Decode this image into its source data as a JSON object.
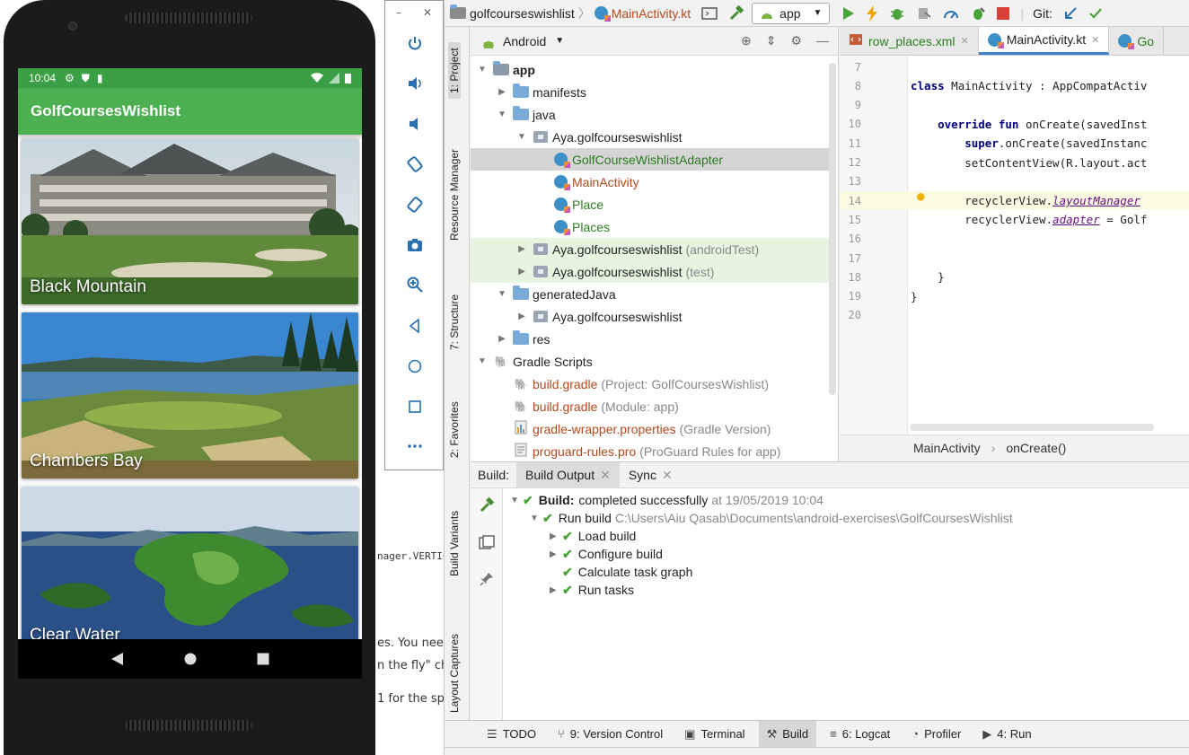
{
  "background_page": {
    "fragments": [
      "nager.VERTIC",
      "es. You need",
      "n the fly\" ch",
      "1 for the sp"
    ]
  },
  "emulator": {
    "window_controls": [
      "–",
      "✕"
    ]
  },
  "phone": {
    "status_time": "10:04",
    "app_title": "GolfCoursesWishlist",
    "places": [
      {
        "name": "Black Mountain"
      },
      {
        "name": "Chambers Bay"
      },
      {
        "name": "Clear Water"
      }
    ]
  },
  "ide": {
    "breadcrumb": {
      "project": "golfcourseswishlist",
      "file": "MainActivity.kt"
    },
    "run_config": "app",
    "git_label": "Git:",
    "left_strip_labels": [
      "1: Project",
      "Resource Manager",
      "7: Structure",
      "2: Favorites",
      "Build Variants",
      "Layout Captures"
    ],
    "project_view": "Android",
    "tree": [
      {
        "label": "app",
        "depth": 0,
        "expanded": true,
        "icon": "module-icon",
        "bold": true
      },
      {
        "label": "manifests",
        "depth": 1,
        "expanded": false,
        "icon": "folder-icon"
      },
      {
        "label": "java",
        "depth": 1,
        "expanded": true,
        "icon": "folder-icon"
      },
      {
        "label": "Aya.golfcourseswishlist",
        "depth": 2,
        "expanded": true,
        "icon": "package-icon"
      },
      {
        "label": "GolfCourseWishlistAdapter",
        "depth": 3,
        "icon": "kotlin-class-icon",
        "color": "#2a7d1f",
        "selected": true
      },
      {
        "label": "MainActivity",
        "depth": 3,
        "icon": "kotlin-class-icon",
        "color": "#b5481b"
      },
      {
        "label": "Place",
        "depth": 3,
        "icon": "kotlin-class-icon",
        "color": "#2a7d1f"
      },
      {
        "label": "Places",
        "depth": 3,
        "icon": "kotlin-class-icon",
        "color": "#2a7d1f"
      },
      {
        "label": "Aya.golfcourseswishlist",
        "suffix": "(androidTest)",
        "depth": 2,
        "expanded": false,
        "icon": "package-icon",
        "test": true
      },
      {
        "label": "Aya.golfcourseswishlist",
        "suffix": "(test)",
        "depth": 2,
        "expanded": false,
        "icon": "package-icon",
        "test": true
      },
      {
        "label": "generatedJava",
        "depth": 1,
        "expanded": true,
        "icon": "folder-icon"
      },
      {
        "label": "Aya.golfcourseswishlist",
        "depth": 2,
        "expanded": false,
        "icon": "package-icon"
      },
      {
        "label": "res",
        "depth": 1,
        "expanded": false,
        "icon": "folder-icon"
      },
      {
        "label": "Gradle Scripts",
        "depth": 0,
        "expanded": true,
        "icon": "gradle-icon"
      },
      {
        "label": "build.gradle",
        "suffix": "(Project: GolfCoursesWishlist)",
        "depth": 1,
        "icon": "gradle-icon",
        "color": "#b5481b"
      },
      {
        "label": "build.gradle",
        "suffix": "(Module: app)",
        "depth": 1,
        "icon": "gradle-icon",
        "color": "#b5481b"
      },
      {
        "label": "gradle-wrapper.properties",
        "suffix": "(Gradle Version)",
        "depth": 1,
        "icon": "properties-icon",
        "color": "#b5481b"
      },
      {
        "label": "proguard-rules.pro",
        "suffix": "(ProGuard Rules for app)",
        "depth": 1,
        "icon": "file-icon",
        "color": "#b5481b"
      }
    ],
    "editor_tabs": [
      {
        "label": "row_places.xml",
        "active": false
      },
      {
        "label": "MainActivity.kt",
        "active": true
      },
      {
        "label": "Go",
        "active": false
      }
    ],
    "code_lines": [
      {
        "ln": "7",
        "text": ""
      },
      {
        "ln": "8",
        "text": "class MainActivity : AppCompatActiv"
      },
      {
        "ln": "9",
        "text": ""
      },
      {
        "ln": "10",
        "text": "    override fun onCreate(savedInst"
      },
      {
        "ln": "11",
        "text": "        super.onCreate(savedInstanc"
      },
      {
        "ln": "12",
        "text": "        setContentView(R.layout.act"
      },
      {
        "ln": "13",
        "text": ""
      },
      {
        "ln": "14",
        "text": "        recyclerView.layoutManager "
      },
      {
        "ln": "15",
        "text": "        recyclerView.adapter = Golf"
      },
      {
        "ln": "16",
        "text": ""
      },
      {
        "ln": "17",
        "text": ""
      },
      {
        "ln": "18",
        "text": "    }"
      },
      {
        "ln": "19",
        "text": "}"
      },
      {
        "ln": "20",
        "text": ""
      }
    ],
    "editor_breadcrumb": [
      "MainActivity",
      "onCreate()"
    ],
    "build": {
      "label": "Build:",
      "tabs": [
        {
          "label": "Build Output",
          "active": true
        },
        {
          "label": "Sync",
          "active": false
        }
      ],
      "rows": [
        {
          "bold": "Build:",
          "text": "completed successfully",
          "muted": "at 19/05/2019 10:04",
          "depth": 0,
          "expander": true
        },
        {
          "text": "Run build",
          "muted": "C:\\Users\\Aiu Qasab\\Documents\\android-exercises\\GolfCoursesWishlist",
          "depth": 1,
          "expander": true
        },
        {
          "text": "Load build",
          "depth": 2,
          "expander": true
        },
        {
          "text": "Configure build",
          "depth": 2,
          "expander": true
        },
        {
          "text": "Calculate task graph",
          "depth": 2,
          "expander": false
        },
        {
          "text": "Run tasks",
          "depth": 2,
          "expander": true
        }
      ]
    },
    "bottom_tools": [
      {
        "label": "TODO",
        "icon": "list-icon"
      },
      {
        "label": "9: Version Control",
        "icon": "vcs-icon"
      },
      {
        "label": "Terminal",
        "icon": "terminal-icon"
      },
      {
        "label": "Build",
        "icon": "hammer-icon",
        "active": true
      },
      {
        "label": "6: Logcat",
        "icon": "logcat-icon"
      },
      {
        "label": "Profiler",
        "icon": "profiler-icon"
      },
      {
        "label": "4: Run",
        "icon": "run-icon"
      }
    ]
  }
}
